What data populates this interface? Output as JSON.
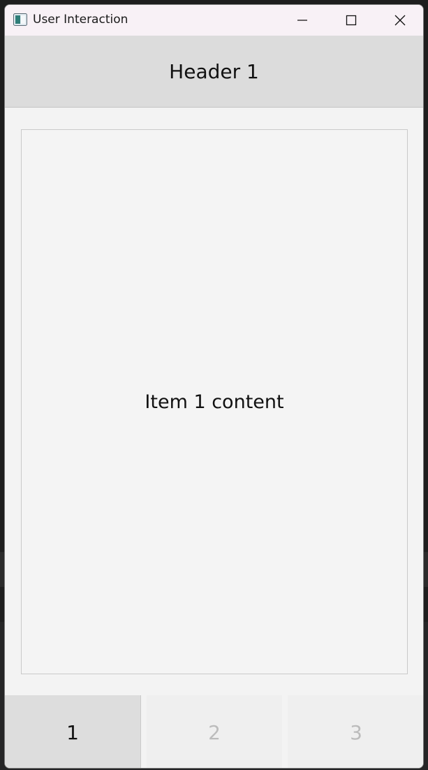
{
  "window": {
    "title": "User Interaction",
    "controls": {
      "minimize_icon": "minimize-icon",
      "maximize_icon": "maximize-icon",
      "close_icon": "close-icon"
    }
  },
  "header": {
    "title": "Header 1"
  },
  "content": {
    "text": "Item 1 content"
  },
  "tabs": [
    {
      "label": "1",
      "selected": true
    },
    {
      "label": "2",
      "selected": false
    },
    {
      "label": "3",
      "selected": false
    }
  ],
  "colors": {
    "titlebar": "#f8f1f6",
    "header_bg": "#dcdcdc",
    "selected_tab_bg": "#dddddd",
    "unselected_tab_text": "#bcbcbc"
  }
}
